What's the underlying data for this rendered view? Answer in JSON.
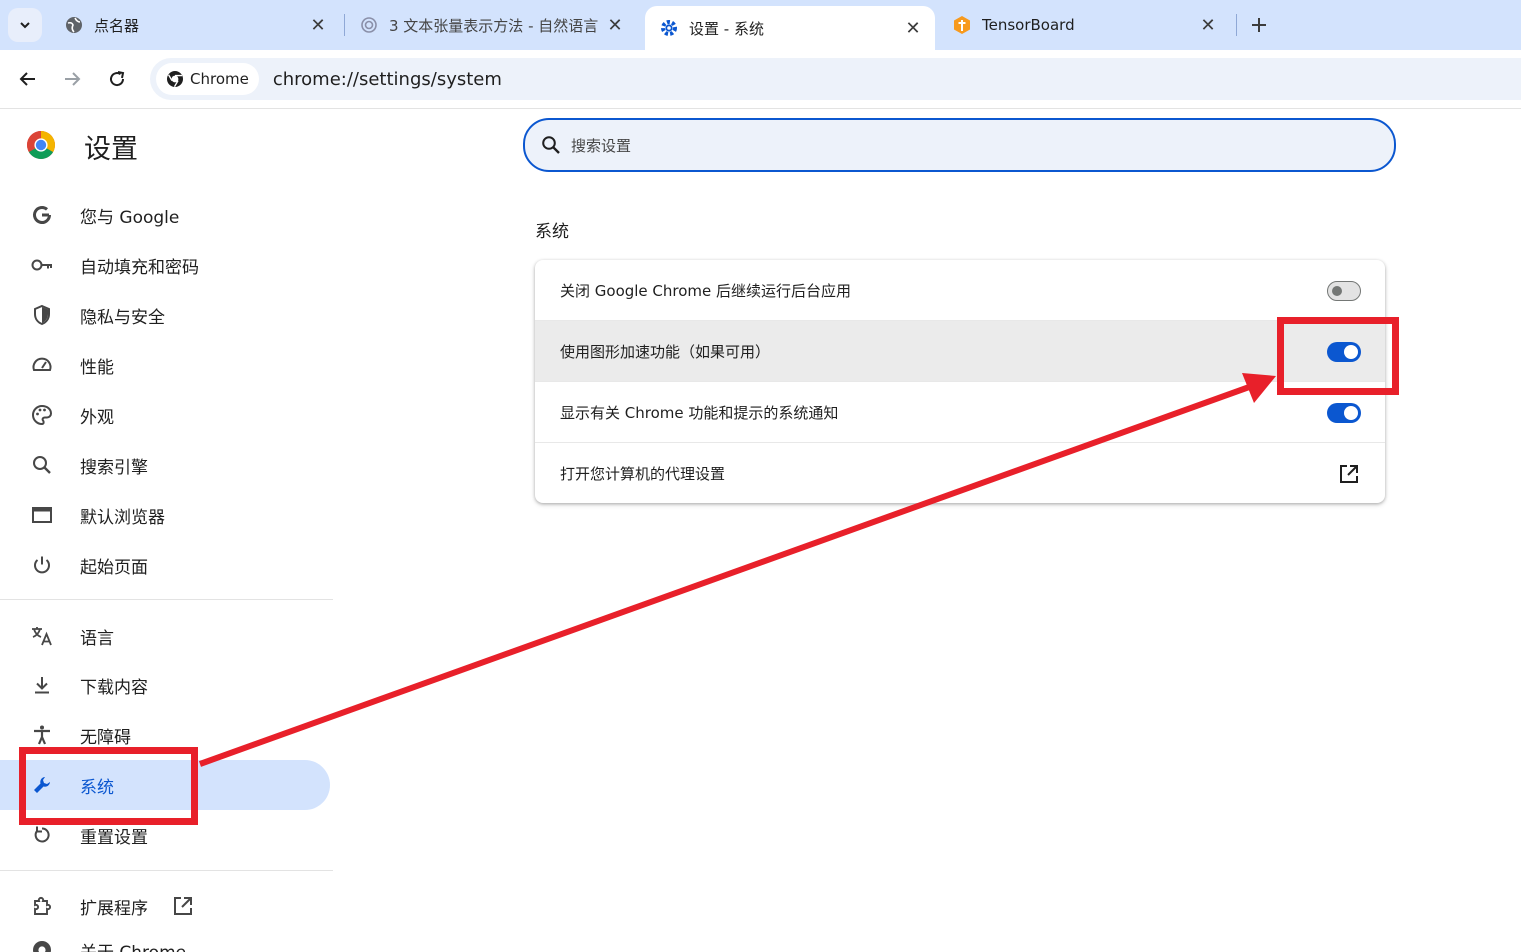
{
  "tabs": [
    {
      "title": "点名器",
      "icon": "globe-icon",
      "active": false
    },
    {
      "title": "3 文本张量表示方法 - 自然语言",
      "icon": "loading-icon",
      "active": false
    },
    {
      "title": "设置 - 系统",
      "icon": "settings-gear-icon",
      "active": true
    },
    {
      "title": "TensorBoard",
      "icon": "tensorflow-icon",
      "active": false
    }
  ],
  "toolbar": {
    "chip_label": "Chrome",
    "url": "chrome://settings/system"
  },
  "sidebar": {
    "title": "设置",
    "items": [
      {
        "label": "您与 Google",
        "icon": "google-g-icon"
      },
      {
        "label": "自动填充和密码",
        "icon": "key-icon"
      },
      {
        "label": "隐私与安全",
        "icon": "shield-icon"
      },
      {
        "label": "性能",
        "icon": "speedometer-icon"
      },
      {
        "label": "外观",
        "icon": "palette-icon"
      },
      {
        "label": "搜索引擎",
        "icon": "search-icon"
      },
      {
        "label": "默认浏览器",
        "icon": "browser-window-icon"
      },
      {
        "label": "起始页面",
        "icon": "power-icon"
      },
      {
        "label": "语言",
        "icon": "translate-icon"
      },
      {
        "label": "下载内容",
        "icon": "download-icon"
      },
      {
        "label": "无障碍",
        "icon": "accessibility-icon"
      },
      {
        "label": "系统",
        "icon": "wrench-icon",
        "selected": true
      },
      {
        "label": "重置设置",
        "icon": "reset-icon"
      },
      {
        "label": "扩展程序",
        "icon": "puzzle-icon"
      },
      {
        "label": "关于 Chrome",
        "icon": "chrome-icon"
      }
    ]
  },
  "search": {
    "placeholder": "搜索设置"
  },
  "main": {
    "section_title": "系统",
    "rows": [
      {
        "label": "关闭 Google Chrome 后继续运行后台应用",
        "control": "toggle",
        "state": "off"
      },
      {
        "label": "使用图形加速功能（如果可用）",
        "control": "toggle",
        "state": "on",
        "highlighted": true
      },
      {
        "label": "显示有关 Chrome 功能和提示的系统通知",
        "control": "toggle",
        "state": "on"
      },
      {
        "label": "打开您计算机的代理设置",
        "control": "external-link"
      }
    ]
  },
  "colors": {
    "accent": "#0b57d0",
    "tabstrip": "#d3e3fd",
    "annotation": "#e8202a"
  }
}
